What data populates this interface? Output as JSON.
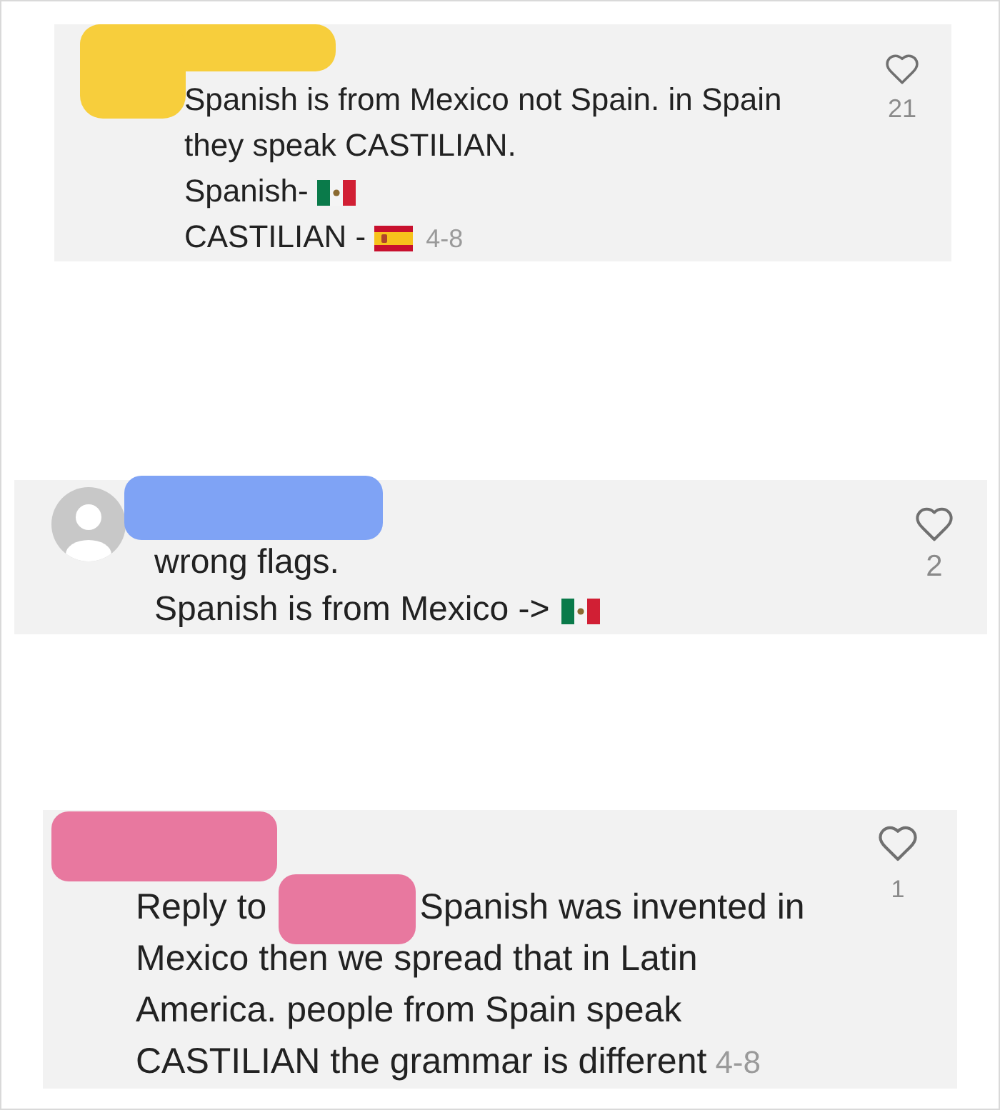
{
  "comments": [
    {
      "username_blur": {
        "color": "#f7ce3c"
      },
      "has_avatar": false,
      "lines": [
        {
          "text": "Spanish is from Mexico not Spain. in Spain they speak CASTILIAN."
        },
        {
          "text": "Spanish-",
          "flag": {
            "kind": "mexico"
          }
        },
        {
          "text": "CASTILIAN -",
          "flag": {
            "kind": "spain"
          }
        }
      ],
      "date": "4-8",
      "likes": "21"
    },
    {
      "username_blur": {
        "color": "#7fa3f5"
      },
      "has_avatar": true,
      "lines": [
        {
          "text": "wrong flags."
        },
        {
          "text": "Spanish is from Mexico ->",
          "flag": {
            "kind": "mexico"
          }
        }
      ],
      "likes": "2"
    },
    {
      "username_blur": {
        "color": "#e8789f"
      },
      "has_avatar": false,
      "reply_to": {
        "label": "Reply to",
        "name_blur": {
          "color": "#e8789f"
        }
      },
      "lines": [
        {
          "text": "Spanish was invented in"
        },
        {
          "text": "Mexico then we spread that in Latin America. people from Spain speak CASTILIAN the grammar is different"
        }
      ],
      "date": "4-8",
      "likes": "1"
    }
  ]
}
